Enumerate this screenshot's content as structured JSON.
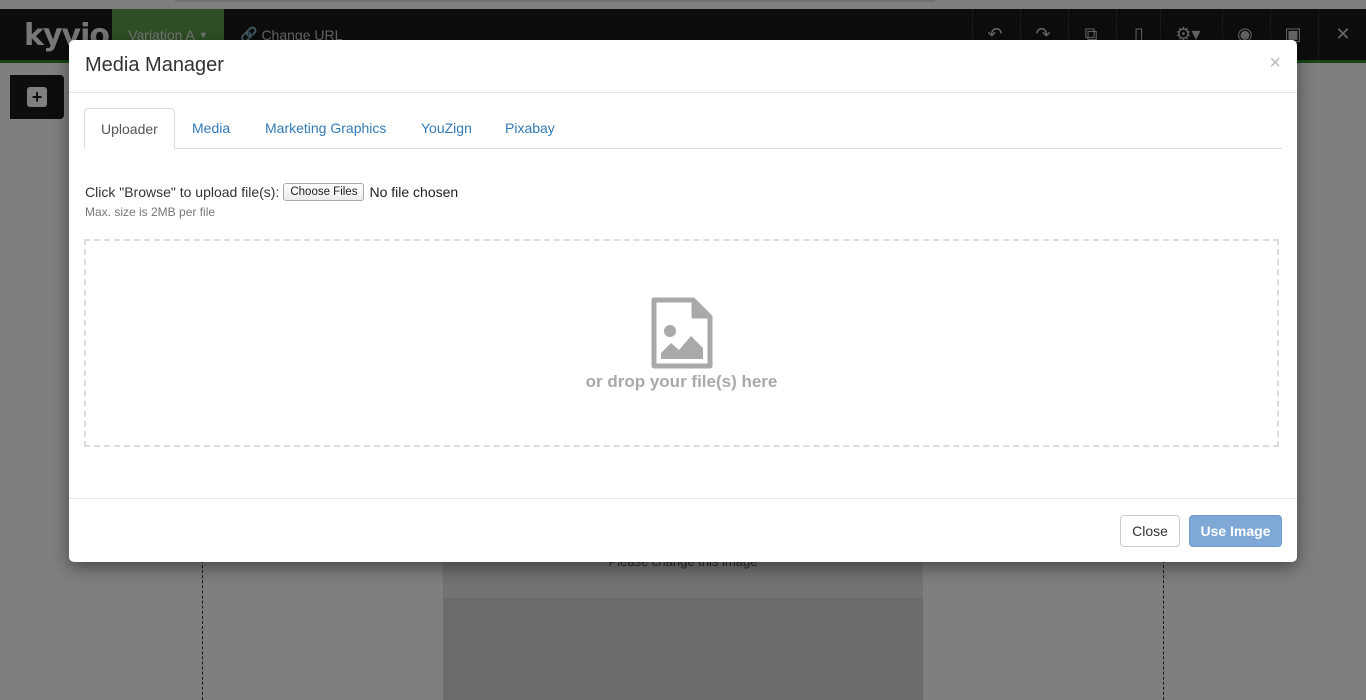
{
  "background_app": {
    "logo": "kyvio",
    "variation_label": "Variation A",
    "change_url_label": "Change URL",
    "placeholder_text": "Please change this image",
    "toolbar_icons": [
      "undo-icon",
      "redo-icon",
      "copy-icon",
      "mobile-icon",
      "gear-icon",
      "eye-icon",
      "save-icon",
      "close-icon"
    ]
  },
  "modal": {
    "title": "Media Manager",
    "close_symbol": "×",
    "tabs": [
      {
        "label": "Uploader",
        "active": true
      },
      {
        "label": "Media",
        "active": false
      },
      {
        "label": "Marketing Graphics",
        "active": false
      },
      {
        "label": "YouZign",
        "active": false
      },
      {
        "label": "Pixabay",
        "active": false
      }
    ],
    "uploader": {
      "browse_prompt": "Click \"Browse\" to upload file(s):",
      "choose_files_label": "Choose Files",
      "file_status": "No file chosen",
      "max_size_note": "Max. size is 2MB per file",
      "drop_text": "or drop your file(s) here",
      "drop_icon": "file-image-icon"
    },
    "footer": {
      "close_label": "Close",
      "use_image_label": "Use Image"
    }
  },
  "colors": {
    "link": "#337ab7",
    "primary_button": "#7ea8d6",
    "toolbar_bg": "#1b1b1b",
    "variation_bg": "#5fa14f",
    "drop_text": "#a9a9a9"
  }
}
